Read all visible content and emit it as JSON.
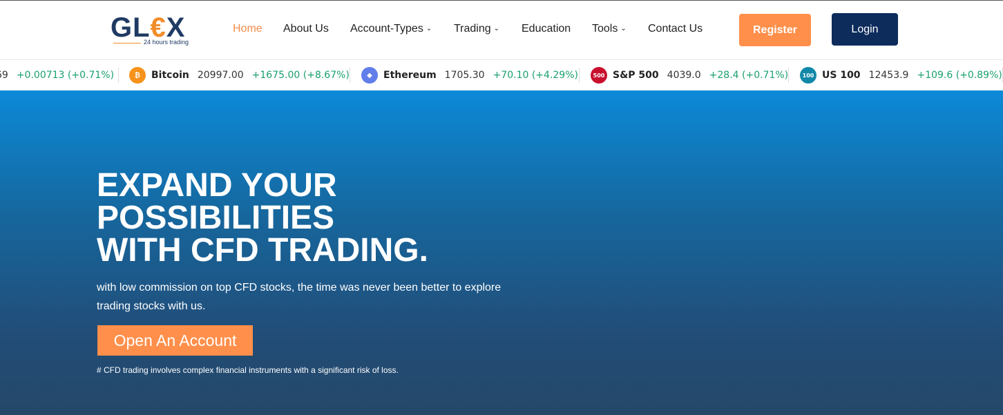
{
  "brand": {
    "logo_prefix": "GL",
    "logo_accent": "€",
    "logo_suffix": "X",
    "tagline": "24 hours trading"
  },
  "nav": {
    "items": [
      {
        "label": "Home",
        "active": true,
        "dropdown": false
      },
      {
        "label": "About Us",
        "active": false,
        "dropdown": false
      },
      {
        "label": "Account-Types",
        "active": false,
        "dropdown": true
      },
      {
        "label": "Trading",
        "active": false,
        "dropdown": true
      },
      {
        "label": "Education",
        "active": false,
        "dropdown": false
      },
      {
        "label": "Tools",
        "active": false,
        "dropdown": true
      },
      {
        "label": "Contact Us",
        "active": false,
        "dropdown": false
      }
    ],
    "caret": "⌄",
    "register_label": "Register",
    "login_label": "Login"
  },
  "ticker": [
    {
      "name": "",
      "price": "69",
      "change": "+0.00713 (+0.71%)",
      "icon": "",
      "icon_color": ""
    },
    {
      "name": "Bitcoin",
      "price": "20997.00",
      "change": "+1675.00 (+8.67%)",
      "icon": "₿",
      "icon_color": "#f7931a"
    },
    {
      "name": "Ethereum",
      "price": "1705.30",
      "change": "+70.10 (+4.29%)",
      "icon": "◆",
      "icon_color": "#627eea"
    },
    {
      "name": "S&P 500",
      "price": "4039.0",
      "change": "+28.4 (+0.71%)",
      "icon": "500",
      "icon_color": "#c8102e"
    },
    {
      "name": "US 100",
      "price": "12453.9",
      "change": "+109.6 (+0.89%)",
      "icon": "100",
      "icon_color": "#1188a8"
    }
  ],
  "hero": {
    "title_lines": [
      "EXPAND YOUR",
      "POSSIBILITIES",
      "WITH CFD TRADING."
    ],
    "subtitle": "with  low commission on top CFD stocks, the time was never been better to explore trading stocks with us.",
    "cta_label": "Open An Account",
    "disclaimer": "# CFD trading involves complex financial instruments with a significant risk of loss."
  },
  "colors": {
    "accent": "#ff8f4a",
    "navy": "#0d2c5c",
    "positive": "#1aa06d"
  }
}
